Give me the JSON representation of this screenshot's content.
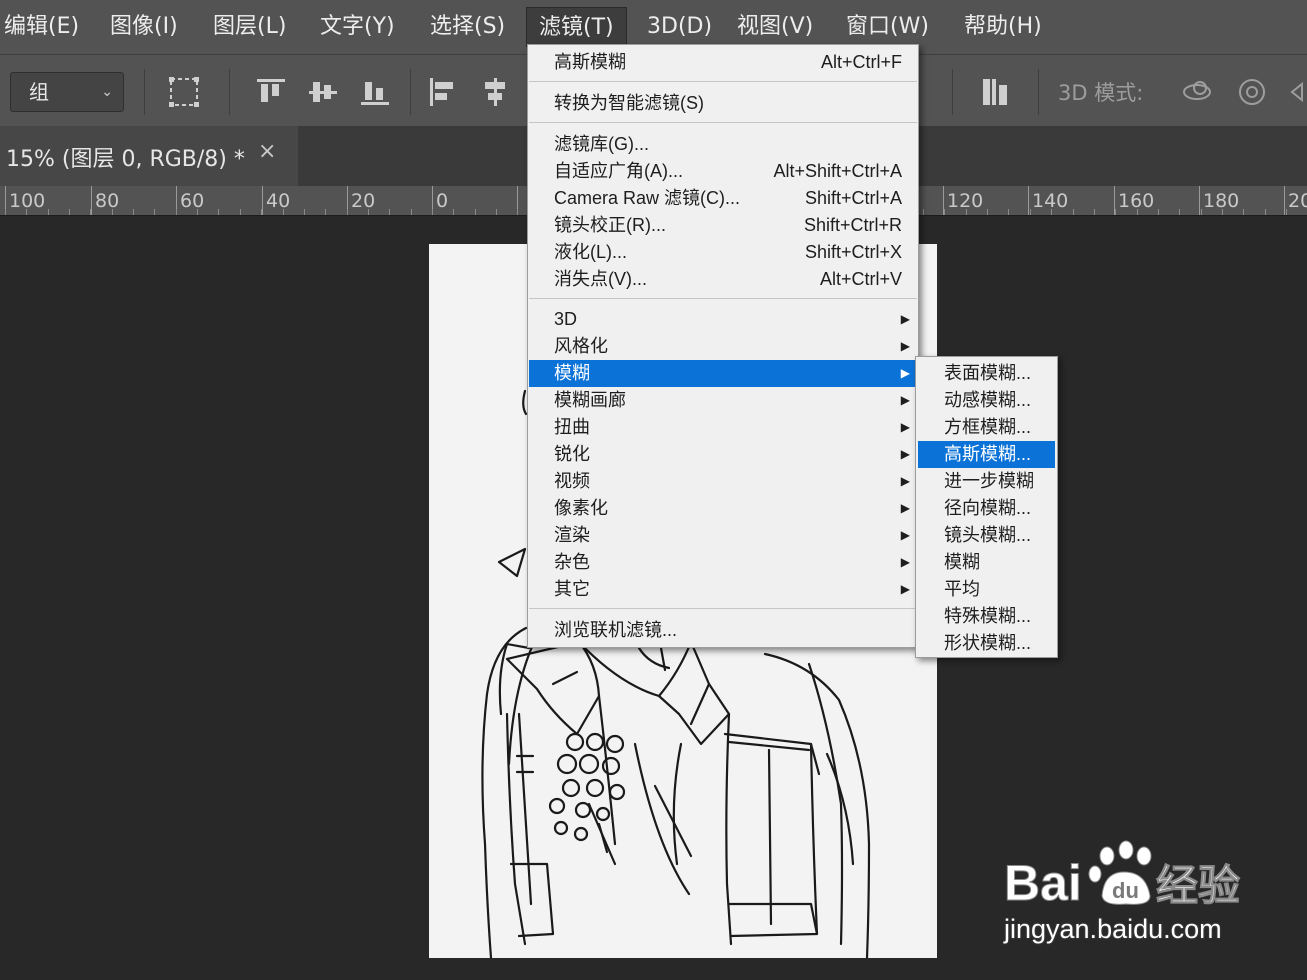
{
  "menubar": {
    "items": [
      "编辑(E)",
      "图像(I)",
      "图层(L)",
      "文字(Y)",
      "选择(S)",
      "滤镜(T)",
      "3D(D)",
      "视图(V)",
      "窗口(W)",
      "帮助(H)"
    ],
    "active_index": 5
  },
  "options_bar": {
    "select_value": "组",
    "mode_label": "3D 模式:"
  },
  "document_tab": {
    "title": "15% (图层 0, RGB/8) *",
    "close_glyph": "×"
  },
  "ruler": {
    "labels": [
      "100",
      "80",
      "60",
      "40",
      "20",
      "0",
      "120",
      "140",
      "160",
      "180",
      "20"
    ]
  },
  "filter_menu": {
    "items": [
      {
        "label": "高斯模糊",
        "shortcut": "Alt+Ctrl+F"
      },
      {
        "label": "转换为智能滤镜(S)",
        "shortcut": ""
      },
      {
        "label": "滤镜库(G)...",
        "shortcut": ""
      },
      {
        "label": "自适应广角(A)...",
        "shortcut": "Alt+Shift+Ctrl+A"
      },
      {
        "label": "Camera Raw 滤镜(C)...",
        "shortcut": "Shift+Ctrl+A"
      },
      {
        "label": "镜头校正(R)...",
        "shortcut": "Shift+Ctrl+R"
      },
      {
        "label": "液化(L)...",
        "shortcut": "Shift+Ctrl+X"
      },
      {
        "label": "消失点(V)...",
        "shortcut": "Alt+Ctrl+V"
      },
      {
        "label": "3D",
        "submenu": true
      },
      {
        "label": "风格化",
        "submenu": true
      },
      {
        "label": "模糊",
        "submenu": true,
        "highlighted": true
      },
      {
        "label": "模糊画廊",
        "submenu": true
      },
      {
        "label": "扭曲",
        "submenu": true
      },
      {
        "label": "锐化",
        "submenu": true
      },
      {
        "label": "视频",
        "submenu": true
      },
      {
        "label": "像素化",
        "submenu": true
      },
      {
        "label": "渲染",
        "submenu": true
      },
      {
        "label": "杂色",
        "submenu": true
      },
      {
        "label": "其它",
        "submenu": true
      },
      {
        "label": "浏览联机滤镜...",
        "shortcut": ""
      }
    ]
  },
  "blur_submenu": {
    "items": [
      "表面模糊...",
      "动感模糊...",
      "方框模糊...",
      "高斯模糊...",
      "进一步模糊",
      "径向模糊...",
      "镜头模糊...",
      "模糊",
      "平均",
      "特殊模糊...",
      "形状模糊..."
    ],
    "highlighted_index": 3
  },
  "watermark": {
    "brand": "Bai",
    "brand_suffix": "经验",
    "site": "jingyan.baidu.com"
  },
  "colors": {
    "highlight": "#0b72d7",
    "menu_bg": "#f0f0f0",
    "app_bg": "#535353",
    "canvas_bg": "#282828"
  }
}
